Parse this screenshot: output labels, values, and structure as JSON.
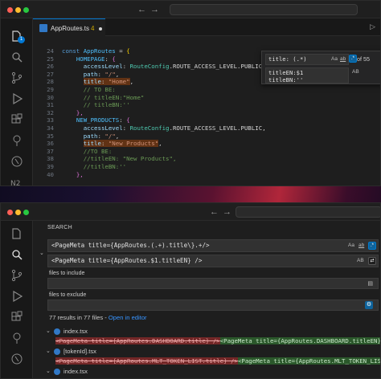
{
  "window1": {
    "tab": {
      "file_name": "AppRoutes.ts",
      "problem_count": "4"
    },
    "line_numbers": [
      "24",
      "25",
      "26",
      "27",
      "28",
      "29",
      "30",
      "31",
      "32",
      "33",
      "34",
      "35",
      "36",
      "37",
      "38",
      "39",
      "40"
    ],
    "code": {
      "l24": {
        "kw": "const ",
        "var": "AppRoutes",
        "rest": " = ",
        "brace": "{"
      },
      "l25": {
        "prop": "HOMEPAGE",
        "rest": ": ",
        "brace": "{"
      },
      "l26": {
        "prop": "accessLevel",
        "rest": ": ",
        "typ": "RouteConfig",
        "rest2": ".ROUTE_ACCESS_LEVEL.PUBLIC,"
      },
      "l27": {
        "prop": "path",
        "rest": ": ",
        "str": "\"/\"",
        "rest2": ","
      },
      "l28": {
        "prop": "title",
        "rest": ": ",
        "str": "\"Home\"",
        "rest2": ","
      },
      "l29": "// TO BE:",
      "l30": "// titleEN:\"Home\"",
      "l31": "// titleBN:''",
      "l32": "},",
      "l33": {
        "prop": "NEW_PRODUCTS",
        "rest": ": ",
        "brace": "{"
      },
      "l34": {
        "prop": "accessLevel",
        "rest": ": ",
        "typ": "RouteConfig",
        "rest2": ".ROUTE_ACCESS_LEVEL.PUBLIC,"
      },
      "l35": {
        "prop": "path",
        "rest": ": ",
        "str": "\"/\"",
        "rest2": ","
      },
      "l36": {
        "prop": "title",
        "rest": ": ",
        "str": "\"New Products\"",
        "rest2": ","
      },
      "l37": "//TO BE:",
      "l38": "//titleEN: \"New Products\",",
      "l39": "//titleBN:''",
      "l40": "},"
    },
    "find_widget": {
      "find_value": "title: (.*)",
      "replace_value_line1": "titleEN:$1",
      "replace_value_line2": "titleBN:''",
      "match_case": "Aa",
      "whole_word": "ab",
      "regex": ".*",
      "match_count": "1 of 55",
      "preserve_case": "AB"
    }
  },
  "window2": {
    "panel_title": "SEARCH",
    "search_value": "<PageMeta title={AppRoutes.(.+).title\\}.+/>",
    "replace_value": "<PageMeta title={AppRoutes.$1.titleEN} />",
    "match_case": "Aa",
    "whole_word": "ab",
    "regex": ".*",
    "preserve_case": "AB",
    "files_include_label": "files to include",
    "files_exclude_label": "files to exclude",
    "summary_text": "77 results in 77 files - ",
    "open_in_editor": "Open in editor",
    "results": [
      {
        "file": "index.tsx",
        "removed": "<PageMeta title={AppRoutes.DASHBOARD.title} />",
        "added": "<PageMeta title={AppRoutes.DASHBOARD.titleEN} />"
      },
      {
        "file": "[tokenId].tsx",
        "removed": "<PageMeta title={AppRoutes.MLT_TOKEN_LIST.title} />",
        "added": "<PageMeta title={AppRoutes.MLT_TOKEN_LIST.titleEN} />"
      },
      {
        "file": "index.tsx"
      }
    ]
  }
}
